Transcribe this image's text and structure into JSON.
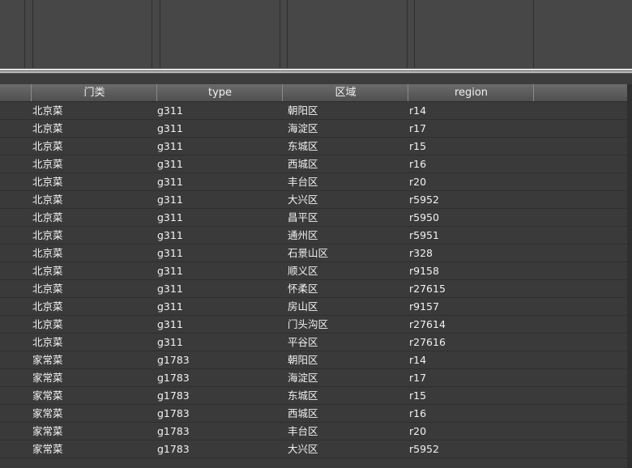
{
  "table": {
    "columns": [
      "门类",
      "type",
      "区域",
      "region"
    ],
    "rows": [
      [
        "北京菜",
        "g311",
        "朝阳区",
        "r14"
      ],
      [
        "北京菜",
        "g311",
        "海淀区",
        "r17"
      ],
      [
        "北京菜",
        "g311",
        "东城区",
        "r15"
      ],
      [
        "北京菜",
        "g311",
        "西城区",
        "r16"
      ],
      [
        "北京菜",
        "g311",
        "丰台区",
        "r20"
      ],
      [
        "北京菜",
        "g311",
        "大兴区",
        "r5952"
      ],
      [
        "北京菜",
        "g311",
        "昌平区",
        "r5950"
      ],
      [
        "北京菜",
        "g311",
        "通州区",
        "r5951"
      ],
      [
        "北京菜",
        "g311",
        "石景山区",
        "r328"
      ],
      [
        "北京菜",
        "g311",
        "顺义区",
        "r9158"
      ],
      [
        "北京菜",
        "g311",
        "怀柔区",
        "r27615"
      ],
      [
        "北京菜",
        "g311",
        "房山区",
        "r9157"
      ],
      [
        "北京菜",
        "g311",
        "门头沟区",
        "r27614"
      ],
      [
        "北京菜",
        "g311",
        "平谷区",
        "r27616"
      ],
      [
        "家常菜",
        "g1783",
        "朝阳区",
        "r14"
      ],
      [
        "家常菜",
        "g1783",
        "海淀区",
        "r17"
      ],
      [
        "家常菜",
        "g1783",
        "东城区",
        "r15"
      ],
      [
        "家常菜",
        "g1783",
        "西城区",
        "r16"
      ],
      [
        "家常菜",
        "g1783",
        "丰台区",
        "r20"
      ],
      [
        "家常菜",
        "g1783",
        "大兴区",
        "r5952"
      ]
    ]
  }
}
